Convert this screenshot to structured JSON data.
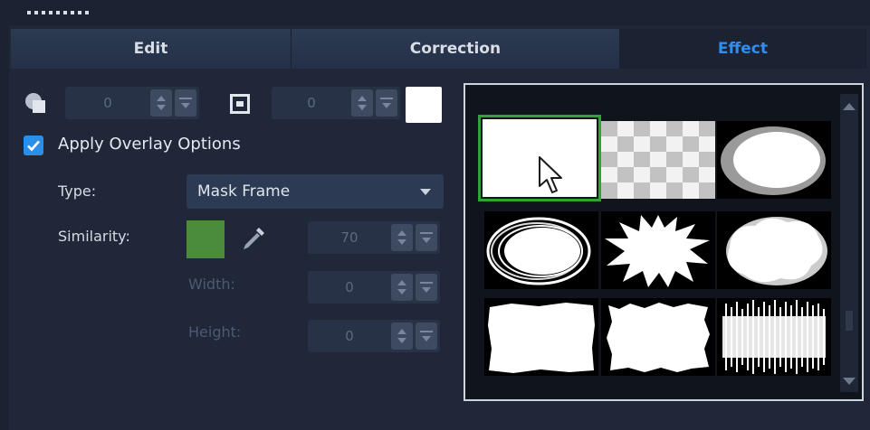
{
  "tabs": [
    {
      "label": "Edit",
      "active": false
    },
    {
      "label": "Correction",
      "active": false
    },
    {
      "label": "Effect",
      "active": true
    }
  ],
  "transparency": {
    "value": "0",
    "icon": "overlay-shape-icon"
  },
  "border": {
    "value": "0",
    "icon": "frame-border-icon",
    "color": "#ffffff"
  },
  "apply_overlay": {
    "label": "Apply Overlay Options",
    "checked": true
  },
  "type": {
    "label": "Type:",
    "value": "Mask Frame"
  },
  "similarity": {
    "label": "Similarity:",
    "color": "#4a8c3c",
    "value": "70"
  },
  "width": {
    "label": "Width:",
    "value": "0"
  },
  "height": {
    "label": "Height:",
    "value": "0"
  },
  "mask_frames": [
    {
      "name": "blank-white",
      "selected": true
    },
    {
      "name": "checker-pattern",
      "selected": false
    },
    {
      "name": "soft-oval",
      "selected": false
    },
    {
      "name": "swirl-oval",
      "selected": false
    },
    {
      "name": "splatter",
      "selected": false
    },
    {
      "name": "cloud",
      "selected": false
    },
    {
      "name": "rough-rectangle",
      "selected": false
    },
    {
      "name": "torn-rectangle",
      "selected": false
    },
    {
      "name": "brush-strokes",
      "selected": false
    }
  ],
  "accent_color": "#2f8ef0",
  "selection_color": "#2fa336"
}
